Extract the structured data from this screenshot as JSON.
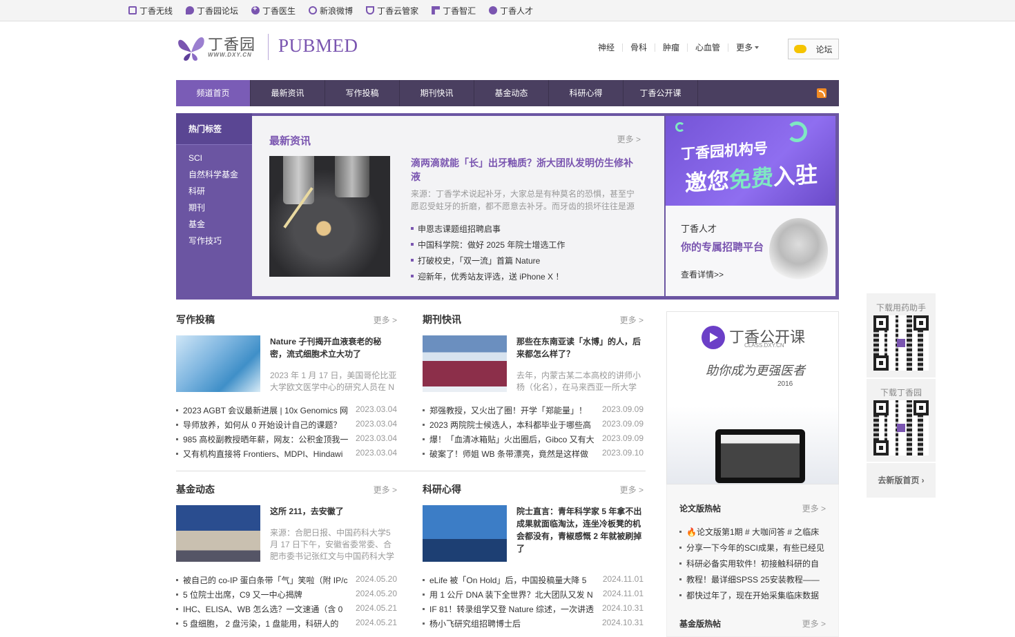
{
  "topbar": {
    "links": [
      {
        "label": "丁香无线",
        "icon": "mobile-icon"
      },
      {
        "label": "丁香园论坛",
        "icon": "forum-icon"
      },
      {
        "label": "丁香医生",
        "icon": "doctor-plus-icon"
      },
      {
        "label": "新浪微博",
        "icon": "weibo-icon"
      },
      {
        "label": "丁香云管家",
        "icon": "cloud-icon"
      },
      {
        "label": "丁香智汇",
        "icon": "zhihui-icon"
      },
      {
        "label": "丁香人才",
        "icon": "talent-icon"
      }
    ]
  },
  "header": {
    "brand": "丁香园",
    "brand_url": "WWW.DXY.CN",
    "section": "PUBMED",
    "nav": [
      "神经",
      "骨科",
      "肿瘤",
      "心血管",
      "更多"
    ],
    "forum_button": "论坛"
  },
  "mainnav": {
    "items": [
      "频道首页",
      "最新资讯",
      "写作投稿",
      "期刊快讯",
      "基金动态",
      "科研心得",
      "丁香公开课"
    ],
    "active": "频道首页"
  },
  "tags": {
    "title": "热门标签",
    "items": [
      "SCI",
      "自然科学基金",
      "科研",
      "期刊",
      "基金",
      "写作技巧"
    ]
  },
  "latest": {
    "title": "最新资讯",
    "more": "更多 >",
    "headline": "滴两滴就能「长」出牙釉质？浙大团队发明仿生修补液",
    "summary": "来源：丁香学术说起补牙，大家总是有种莫名的恐惧，甚至宁愿忍受蛀牙的折磨，都不愿意去补牙。而牙齿的损坏往往是源",
    "items": [
      "申恩志课题组招聘启事",
      "中国科学院：做好 2025 年院士增选工作",
      "打破校史，「双一流」首篇 Nature",
      "迎新年，优秀站友评选，送 iPhone X ！"
    ]
  },
  "ads": {
    "ad1_line1": "丁香园机构号",
    "ad1_line2a": "邀您",
    "ad1_line2b": "免费",
    "ad1_line2c": "入驻",
    "ad2_title": "丁香人才",
    "ad2_slogan": "你的专属招聘平台",
    "ad2_link": "查看详情>>"
  },
  "columns": [
    {
      "title": "写作投稿",
      "more": "更多 >",
      "feature_title": "Nature 子刊揭开血液衰老的秘密，流式细胞术立大功了",
      "feature_desc": "2023 年 1 月 17 日，美国哥伦比亚大学欧文医学中心的研究人员在 N",
      "rows": [
        {
          "t": "2023 AGBT 会议最新进展 | 10x Genomics 网",
          "d": "2023.03.04"
        },
        {
          "t": "导师放养，如何从 0 开始设计自己的课题？",
          "d": "2023.03.04"
        },
        {
          "t": "985 高校副教授晒年薪，网友：公积金顶我一",
          "d": "2023.03.04"
        },
        {
          "t": "又有机构直接将 Frontiers、MDPI、Hindawi",
          "d": "2023.03.04"
        }
      ]
    },
    {
      "title": "期刊快讯",
      "more": "更多 >",
      "feature_title": "那些在东南亚读「水博」的人，后来都怎么样了？",
      "feature_desc": "去年，内蒙古某二本高校的讲师小杨（化名），在马来西亚一所大学",
      "rows": [
        {
          "t": "郑强教授，又火出了圈！开学「郑能量」！",
          "d": "2023.09.09"
        },
        {
          "t": "2023 两院院士候选人，本科都毕业于哪些高",
          "d": "2023.09.09"
        },
        {
          "t": "爆！「血清冰箱贴」火出圈后，Gibco 又有大",
          "d": "2023.09.09"
        },
        {
          "t": "破案了！师姐 WB 条带漂亮，竟然是这样做",
          "d": "2023.09.10"
        }
      ]
    },
    {
      "title": "基金动态",
      "more": "更多 >",
      "feature_title": "这所 211，去安徽了",
      "feature_desc": "来源：合肥日报、中国药科大学5 月 17 日下午，安徽省委常委、合肥市委书记张红文与中国药科大学",
      "rows": [
        {
          "t": "被自己的 co-IP 蛋白条带「气」笑啦（附 IP/c",
          "d": "2024.05.20"
        },
        {
          "t": "5 位院士出席，C9 又一中心揭牌",
          "d": "2024.05.20"
        },
        {
          "t": "IHC、ELISA、WB 怎么选？一文速通（含 0",
          "d": "2024.05.21"
        },
        {
          "t": "5 盘细胞， 2 盘污染，1 盘能用，科研人的",
          "d": "2024.05.21"
        }
      ]
    },
    {
      "title": "科研心得",
      "more": "更多 >",
      "feature_title": "院士直言：青年科学家 5 年拿不出成果就面临淘汰，连坐冷板凳的机会都没有，青椒感慨 2 年就被刷掉了",
      "feature_desc": "",
      "rows": [
        {
          "t": "eLife 被「On Hold」后，中国投稿量大降 5",
          "d": "2024.11.01"
        },
        {
          "t": "用 1 公斤 DNA 装下全世界？北大团队又发 N",
          "d": "2024.11.01"
        },
        {
          "t": "IF 81！转录组学又登 Nature 综述，一次讲透",
          "d": "2024.10.31"
        },
        {
          "t": "杨小飞研究组招聘博士后",
          "d": "2024.10.31"
        }
      ]
    }
  ],
  "course": {
    "name": "丁香公开课",
    "url": "CLASS.DXY.CN",
    "slogan": "助你成为更强医者",
    "year": "2016"
  },
  "hot1": {
    "title": "论文版热帖",
    "more": "更多 >",
    "items": [
      "🔥论文版第1期 # 大咖问答 # 之临床",
      "分享一下今年的SCI成果，有些已经见",
      "科研必备实用软件！初接触科研的自",
      "教程！最详细SPSS 25安装教程——",
      "都快过年了，现在开始采集临床数据"
    ]
  },
  "hot2": {
    "title": "基金版热帖",
    "more": "更多 >"
  },
  "float": {
    "qr1_label": "下载用药助手",
    "qr2_label": "下载丁香园",
    "back": "去新版首页"
  }
}
